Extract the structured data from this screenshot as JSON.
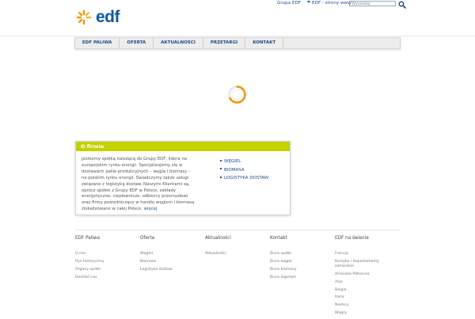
{
  "header": {
    "logo_text": "edf",
    "links": [
      "Grupa EDF",
      "EDF - strony www"
    ],
    "search_placeholder": "Wyszukaj"
  },
  "nav": {
    "items": [
      "EDF PALIWA",
      "OFERTA",
      "AKTUALNOŚCI",
      "PRZETARGI",
      "KONTAKT"
    ]
  },
  "about": {
    "title": "O firmie",
    "text": "Jesteśmy spółką należącą do Grupy EDF, lidera na europejskim rynku energii. Specjalizujemy się w dostawach paliw produkcyjnych – węgla i biomasy – na polskim rynku energii. Świadczymy także usługi związane z logistyką dostaw. Naszymi Klientami są, oprócz spółek z Grupy EDF w Polsce, zakłady energetyczne, ciepłownicze, odbiorcy przemysłowi oraz firmy pośredniczące w handlu węglem i biomasą zlokalizowane w całej Polsce.",
    "more": "więcej",
    "links": [
      "WĘGIEL",
      "BIOMASA",
      "LOGISTYKA DOSTAW"
    ]
  },
  "footer": {
    "columns": [
      {
        "title": "EDF Paliwa",
        "links": [
          "O nas",
          "Rys historyczny",
          "Organy spółki",
          "Dochód nas"
        ]
      },
      {
        "title": "Oferta",
        "links": [
          "Węgiel",
          "Biomasa",
          "Logistyka dostaw"
        ]
      },
      {
        "title": "Aktualności",
        "links": [
          "Aktualności"
        ]
      },
      {
        "title": "Kontakt",
        "links": [
          "Biuro spółki",
          "Biuro węgla",
          "Biuro biomasy",
          "Biuro logistyki"
        ]
      },
      {
        "title": "EDF na świecie",
        "links": [
          "Francja",
          "Korsyka i departamenty zamorskie",
          "Ameryka Północna",
          "Azja",
          "Belgia",
          "Italia",
          "Niemcy",
          "Węgry"
        ]
      }
    ]
  },
  "colors": {
    "brand_blue": "#1057a6",
    "brand_orange": "#f39200",
    "accent_green": "#c4d200"
  }
}
